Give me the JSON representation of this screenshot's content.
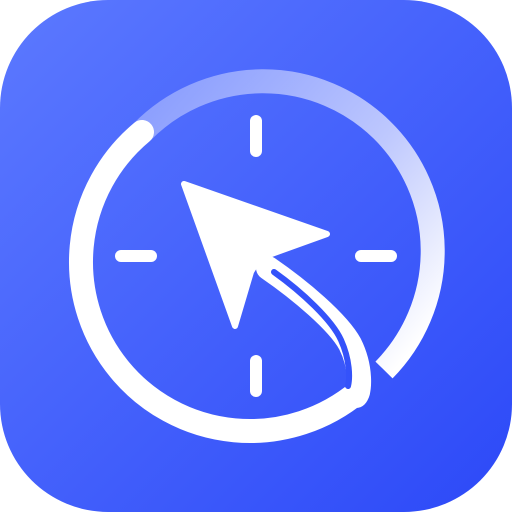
{
  "app_icon": {
    "icon_name": "compass-clock-cursor-icon",
    "colors": {
      "tile_gradient_start": "#5a76ff",
      "tile_gradient_end": "#2f4dfa",
      "glyph": "#ffffff"
    }
  }
}
